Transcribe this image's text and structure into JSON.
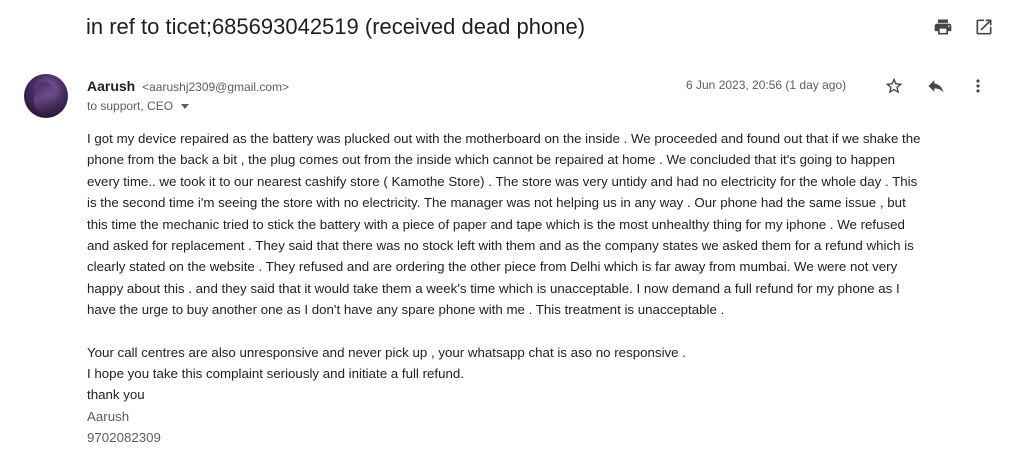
{
  "subject": "in ref to ticet;685693042519 (received dead phone)",
  "top_actions": {
    "print_icon": "print-icon",
    "open_new_window_icon": "open-in-new-icon"
  },
  "message": {
    "sender_name": "Aarush",
    "sender_email": "<aarushj2309@gmail.com>",
    "to_line": "to support, CEO",
    "date": "6 Jun 2023, 20:56 (1 day ago)",
    "actions": [
      "star-icon",
      "reply-icon",
      "more-vert-icon"
    ],
    "paragraph1": [
      "I got my device repaired as the battery was plucked out  with the motherboard on the inside . We proceeded and found out that if we shake the",
      "phone from the back a bit , the plug comes out from the inside which cannot be repaired at home . We concluded that it's going to happen",
      "every time.. we took it to our nearest cashify store ( Kamothe Store) . The store was very untidy and had no electricity for the whole day . This",
      "is the second time i'm seeing the store with no electricity. The manager was not helping us in any way . Our phone had the same issue , but",
      "this time the mechanic tried to stick the battery with a piece of paper and tape which is the most unhealthy thing for my iphone . We refused",
      "and asked for  replacement . They said that there was no stock left with them and as the company states we asked them for a refund which is",
      "clearly stated on the website . They refused and are ordering the other piece from Delhi which is far away from mumbai. We were not very",
      "happy about this . and they said that it would take them a week's time which is unacceptable. I now demand a full refund for my phone as I",
      "have the urge to buy another one as I don't have any spare phone with me . This treatment is unacceptable ."
    ],
    "line_call_centres": "Your call centres are also unresponsive and never pick up , your whatsapp chat is aso no responsive .",
    "line_hope": "I hope you take this complaint seriously and initiate a full refund.",
    "line_thanks": "thank you",
    "signature_name": "Aarush",
    "signature_phone": "9702082309"
  }
}
